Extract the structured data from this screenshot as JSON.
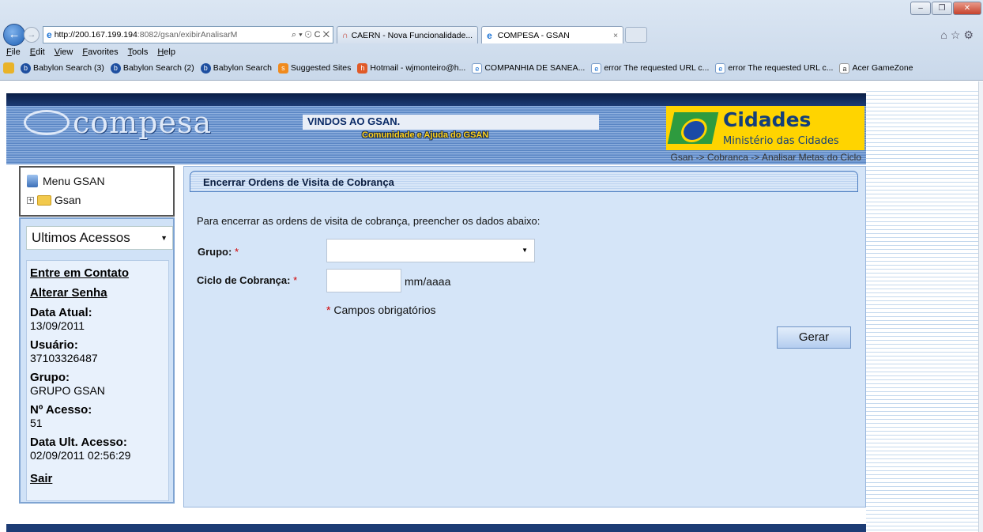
{
  "browser": {
    "address_host": "http://200.167.199.194",
    "address_path": ":8082/gsan/exibirAnalisarM",
    "address_controls": "⌕ ▾ ☉ C ✕",
    "tabs": [
      {
        "label": "CAERN - Nova Funcionalidade...",
        "active": false
      },
      {
        "label": "COMPESA - GSAN",
        "active": true
      }
    ],
    "tab_close": "×",
    "menu": [
      "File",
      "Edit",
      "View",
      "Favorites",
      "Tools",
      "Help"
    ],
    "favorites": [
      "Babylon Search (3)",
      "Babylon Search (2)",
      "Babylon Search",
      "Suggested Sites",
      "Hotmail - wjmonteiro@h...",
      "COMPANHIA DE SANEA...",
      "error The requested URL c...",
      "error The requested URL c...",
      "Acer GameZone"
    ]
  },
  "header": {
    "logo_text": "compesa",
    "welcome": "VINDOS AO GSAN.",
    "community": "Comunidade e Ajuda do GSAN",
    "cidades_title": "Cidades",
    "cidades_sub": "Ministério das Cidades",
    "breadcrumb": "Gsan -> Cobranca -> Analisar Metas do Ciclo"
  },
  "sidebar": {
    "menu_title": "Menu GSAN",
    "tree_root": "Gsan",
    "last_access_select": "Ultimos Acessos",
    "contact_link": "Entre em Contato",
    "password_link": "Alterar Senha",
    "current_date_label": "Data Atual:",
    "current_date": "13/09/2011",
    "user_label": "Usuário:",
    "user": "37103326487",
    "group_label": "Grupo:",
    "group": "GRUPO GSAN",
    "access_label": "Nº Acesso:",
    "access": "51",
    "last_access_label": "Data Ult. Acesso:",
    "last_access": "02/09/2011 02:56:29",
    "logout_link": "Sair"
  },
  "form": {
    "title": "Encerrar Ordens de Visita de Cobrança",
    "instructions": "Para encerrar as ordens de visita de cobrança, preencher os dados abaixo:",
    "grupo_label": "Grupo:",
    "grupo_value": "",
    "ciclo_label": "Ciclo de Cobrança:",
    "ciclo_value": "",
    "ciclo_unit": "mm/aaaa",
    "required_mark": "*",
    "required_note": "Campos obrigatórios",
    "submit_label": "Gerar"
  }
}
